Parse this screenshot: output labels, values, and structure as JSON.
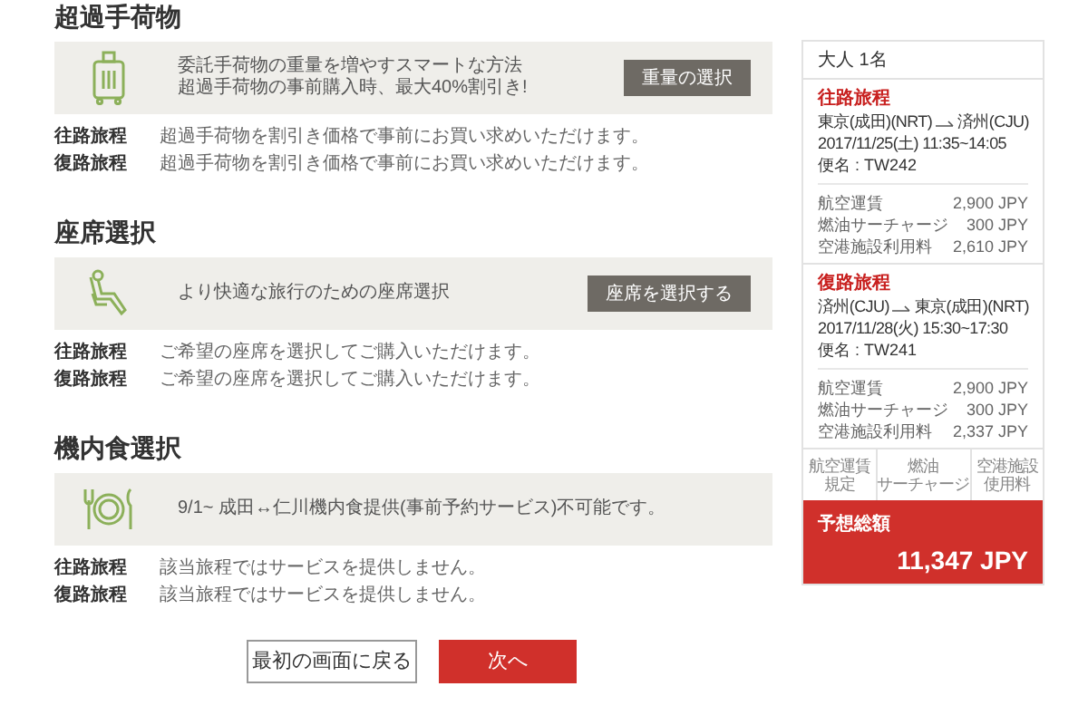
{
  "sections": [
    {
      "title": "超過手荷物",
      "kind": "luggage",
      "message": [
        "委託手荷物の重量を増やすスマートな方法",
        "超過手荷物の事前購入時、最大40%割引き!"
      ],
      "button": "重量の選択",
      "rows": [
        {
          "label": "往路旅程",
          "text": "超過手荷物を割引き価格で事前にお買い求めいただけます。"
        },
        {
          "label": "復路旅程",
          "text": "超過手荷物を割引き価格で事前にお買い求めいただけます。"
        }
      ]
    },
    {
      "title": "座席選択",
      "kind": "seat",
      "message": [
        "より快適な旅行のための座席選択"
      ],
      "button": "座席を選択する",
      "rows": [
        {
          "label": "往路旅程",
          "text": "ご希望の座席を選択してご購入いただけます。"
        },
        {
          "label": "復路旅程",
          "text": "ご希望の座席を選択してご購入いただけます。"
        }
      ]
    },
    {
      "title": "機内食選択",
      "kind": "meal",
      "message": [
        "9/1~ 成田↔仁川機内食提供(事前予約サービス)不可能です。"
      ],
      "rows": [
        {
          "label": "往路旅程",
          "text": "該当旅程ではサービスを提供しません。"
        },
        {
          "label": "復路旅程",
          "text": "該当旅程ではサービスを提供しません。"
        }
      ]
    }
  ],
  "buttons": [
    {
      "label": "最初の画面に戻る",
      "kind": "secondary"
    },
    {
      "label": "次へ",
      "kind": "primary"
    }
  ],
  "summary": {
    "passengers": "大人 1名",
    "legs": [
      {
        "title": "往路旅程",
        "from": "東京(成田)(NRT)",
        "to": "済州(CJU)",
        "datetime": "2017/11/25(土) 11:35~14:05",
        "flight": "便名 : TW242",
        "fees": [
          {
            "label": "航空運賃",
            "amount": "2,900 JPY"
          },
          {
            "label": "燃油サーチャージ",
            "amount": "300 JPY"
          },
          {
            "label": "空港施設利用料",
            "amount": "2,610 JPY"
          }
        ]
      },
      {
        "title": "復路旅程",
        "from": "済州(CJU)",
        "to": "東京(成田)(NRT)",
        "datetime": "2017/11/28(火) 15:30~17:30",
        "flight": "便名 : TW241",
        "fees": [
          {
            "label": "航空運賃",
            "amount": "2,900 JPY"
          },
          {
            "label": "燃油サーチャージ",
            "amount": "300 JPY"
          },
          {
            "label": "空港施設利用料",
            "amount": "2,337 JPY"
          }
        ]
      }
    ],
    "links": [
      [
        "航空運賃",
        "規定"
      ],
      [
        "燃油",
        "サーチャージ"
      ],
      [
        "空港施設",
        "使用料"
      ]
    ],
    "total_label": "予想総額",
    "total": "11,347 JPY"
  }
}
